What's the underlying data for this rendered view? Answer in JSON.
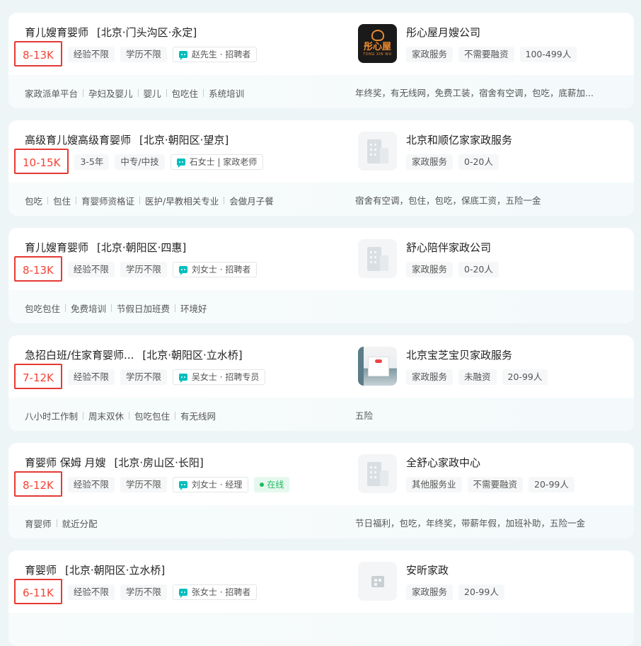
{
  "jobs": [
    {
      "title": "育儿嫂育婴师",
      "area": "[北京·门头沟区·永定]",
      "salary": "8-13K",
      "tags": [
        "经验不限",
        "学历不限"
      ],
      "boss": "赵先生 · 招聘者",
      "online": "",
      "skills": [
        "家政派单平台",
        "孕妇及婴儿",
        "婴儿",
        "包吃住",
        "系统培训"
      ],
      "company": "彤心屋月嫂公司",
      "logo_type": "brand",
      "logo_text": "彤心屋",
      "logo_sub": "TONG XIN WU",
      "company_tags": [
        "家政服务",
        "不需要融资",
        "100-499人"
      ],
      "benefits": "年终奖，有无线网，免费工装，宿舍有空调，包吃，底薪加..."
    },
    {
      "title": "高级育儿嫂高级育婴师",
      "area": "[北京·朝阳区·望京]",
      "salary": "10-15K",
      "tags": [
        "3-5年",
        "中专/中技"
      ],
      "boss": "石女士 | 家政老师",
      "online": "",
      "skills": [
        "包吃",
        "包住",
        "育婴师资格证",
        "医护/早教相关专业",
        "会做月子餐"
      ],
      "company": "北京和顺亿家家政服务",
      "logo_type": "building",
      "company_tags": [
        "家政服务",
        "0-20人"
      ],
      "benefits": "宿舍有空调，包住，包吃，保底工资，五险一金"
    },
    {
      "title": "育儿嫂育婴师",
      "area": "[北京·朝阳区·四惠]",
      "salary": "8-13K",
      "tags": [
        "经验不限",
        "学历不限"
      ],
      "boss": "刘女士 · 招聘者",
      "online": "",
      "skills": [
        "包吃包住",
        "免费培训",
        "节假日加班费",
        "环境好"
      ],
      "company": "舒心陪伴家政公司",
      "logo_type": "building",
      "company_tags": [
        "家政服务",
        "0-20人"
      ],
      "benefits": ""
    },
    {
      "title": "急招白班/住家育婴师...",
      "area": "[北京·朝阳区·立水桥]",
      "salary": "7-12K",
      "tags": [
        "经验不限",
        "学历不限"
      ],
      "boss": "吴女士 · 招聘专员",
      "online": "",
      "skills": [
        "八小时工作制",
        "周末双休",
        "包吃包住",
        "有无线网"
      ],
      "company": "北京宝芝宝贝家政服务",
      "logo_type": "photo",
      "company_tags": [
        "家政服务",
        "未融资",
        "20-99人"
      ],
      "benefits": "五险"
    },
    {
      "title": "育婴师 保姆 月嫂",
      "area": "[北京·房山区·长阳]",
      "salary": "8-12K",
      "tags": [
        "经验不限",
        "学历不限"
      ],
      "boss": "刘女士 · 经理",
      "online": "在线",
      "skills": [
        "育婴师",
        "就近分配"
      ],
      "company": "全舒心家政中心",
      "logo_type": "building",
      "company_tags": [
        "其他服务业",
        "不需要融资",
        "20-99人"
      ],
      "benefits": "节日福利，包吃，年终奖，带薪年假，加班补助，五险一金"
    },
    {
      "title": "育婴师",
      "area": "[北京·朝阳区·立水桥]",
      "salary": "6-11K",
      "tags": [
        "经验不限",
        "学历不限"
      ],
      "boss": "张女士 · 招聘者",
      "online": "",
      "skills": [],
      "company": "安昕家政",
      "logo_type": "small-bld",
      "company_tags": [
        "家政服务",
        "20-99人"
      ],
      "benefits": ""
    }
  ]
}
